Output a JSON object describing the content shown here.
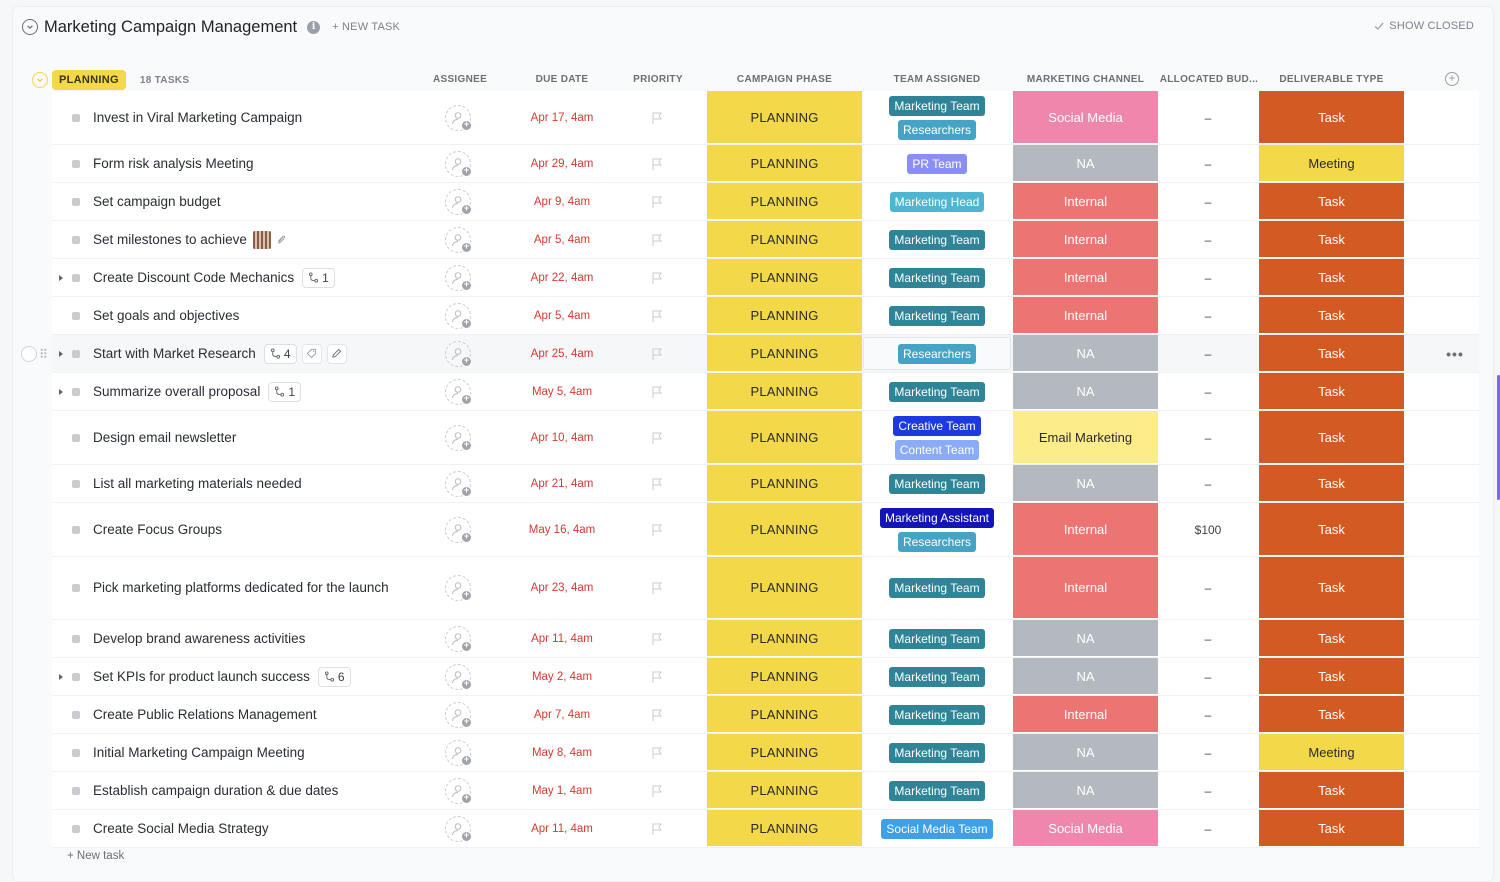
{
  "header": {
    "title": "Marketing Campaign Management",
    "new_task_label": "+ NEW TASK",
    "show_closed_label": "SHOW CLOSED"
  },
  "group": {
    "status": "PLANNING",
    "task_count": "18 TASKS",
    "status_color": "#f3d949"
  },
  "columns": {
    "assignee": "ASSIGNEE",
    "due_date": "DUE DATE",
    "priority": "PRIORITY",
    "campaign_phase": "CAMPAIGN PHASE",
    "team_assigned": "TEAM ASSIGNED",
    "marketing_channel": "MARKETING CHANNEL",
    "allocated_budget": "ALLOCATED BUD...",
    "deliverable_type": "DELIVERABLE TYPE"
  },
  "colors": {
    "team": {
      "Marketing Team": "#2f8597",
      "Researchers": "#45a4c5",
      "PR Team": "#8b8ff5",
      "Marketing Head": "#4eb6d0",
      "Creative Team": "#1c3ae0",
      "Content Team": "#8aabf7",
      "Marketing Assistant": "#1414b8",
      "Social Media Team": "#3da0e8"
    },
    "channel": {
      "Social Media": "#ee87ab",
      "NA": "#b4b9bf",
      "Internal": "#ec7473",
      "Email Marketing": "#fdec8a"
    },
    "deliverable": {
      "Task": "#d35a23",
      "Meeting": "#f3d949"
    },
    "due_date": "#d33a2f"
  },
  "tasks": [
    {
      "name": "Invest in Viral Marketing Campaign",
      "due": "Apr 17, 4am",
      "phase": "PLANNING",
      "teams": [
        "Marketing Team",
        "Researchers"
      ],
      "channel": "Social Media",
      "budget": "–",
      "deliverable": "Task"
    },
    {
      "name": "Form risk analysis Meeting",
      "due": "Apr 29, 4am",
      "phase": "PLANNING",
      "teams": [
        "PR Team"
      ],
      "channel": "NA",
      "budget": "–",
      "deliverable": "Meeting"
    },
    {
      "name": "Set campaign budget",
      "due": "Apr 9, 4am",
      "phase": "PLANNING",
      "teams": [
        "Marketing Head"
      ],
      "channel": "Internal",
      "budget": "–",
      "deliverable": "Task"
    },
    {
      "name": "Set milestones to achieve",
      "due": "Apr 5, 4am",
      "phase": "PLANNING",
      "teams": [
        "Marketing Team"
      ],
      "channel": "Internal",
      "budget": "–",
      "deliverable": "Task",
      "attachment": true
    },
    {
      "name": "Create Discount Code Mechanics",
      "due": "Apr 22, 4am",
      "phase": "PLANNING",
      "teams": [
        "Marketing Team"
      ],
      "channel": "Internal",
      "budget": "–",
      "deliverable": "Task",
      "subtasks": "1"
    },
    {
      "name": "Set goals and objectives",
      "due": "Apr 5, 4am",
      "phase": "PLANNING",
      "teams": [
        "Marketing Team"
      ],
      "channel": "Internal",
      "budget": "–",
      "deliverable": "Task"
    },
    {
      "name": "Start with Market Research",
      "due": "Apr 25, 4am",
      "phase": "PLANNING",
      "teams": [
        "Researchers"
      ],
      "channel": "NA",
      "budget": "–",
      "deliverable": "Task",
      "subtasks": "4",
      "hover": true
    },
    {
      "name": "Summarize overall proposal",
      "due": "May 5, 4am",
      "phase": "PLANNING",
      "teams": [
        "Marketing Team"
      ],
      "channel": "NA",
      "budget": "–",
      "deliverable": "Task",
      "subtasks": "1"
    },
    {
      "name": "Design email newsletter",
      "due": "Apr 10, 4am",
      "phase": "PLANNING",
      "teams": [
        "Creative Team",
        "Content Team"
      ],
      "channel": "Email Marketing",
      "budget": "–",
      "deliverable": "Task"
    },
    {
      "name": "List all marketing materials needed",
      "due": "Apr 21, 4am",
      "phase": "PLANNING",
      "teams": [
        "Marketing Team"
      ],
      "channel": "NA",
      "budget": "–",
      "deliverable": "Task"
    },
    {
      "name": "Create Focus Groups",
      "due": "May 16, 4am",
      "phase": "PLANNING",
      "teams": [
        "Marketing Assistant",
        "Researchers"
      ],
      "channel": "Internal",
      "budget": "$100",
      "deliverable": "Task"
    },
    {
      "name": "Pick marketing platforms dedicated for the launch",
      "due": "Apr 23, 4am",
      "phase": "PLANNING",
      "teams": [
        "Marketing Team"
      ],
      "channel": "Internal",
      "budget": "–",
      "deliverable": "Task"
    },
    {
      "name": "Develop brand awareness activities",
      "due": "Apr 11, 4am",
      "phase": "PLANNING",
      "teams": [
        "Marketing Team"
      ],
      "channel": "NA",
      "budget": "–",
      "deliverable": "Task"
    },
    {
      "name": "Set KPIs for product launch success",
      "due": "May 2, 4am",
      "phase": "PLANNING",
      "teams": [
        "Marketing Team"
      ],
      "channel": "NA",
      "budget": "–",
      "deliverable": "Task",
      "subtasks": "6"
    },
    {
      "name": "Create Public Relations Management",
      "due": "Apr 7, 4am",
      "phase": "PLANNING",
      "teams": [
        "Marketing Team"
      ],
      "channel": "Internal",
      "budget": "–",
      "deliverable": "Task"
    },
    {
      "name": "Initial Marketing Campaign Meeting",
      "due": "May 8, 4am",
      "phase": "PLANNING",
      "teams": [
        "Marketing Team"
      ],
      "channel": "NA",
      "budget": "–",
      "deliverable": "Meeting"
    },
    {
      "name": "Establish campaign duration & due dates",
      "due": "May 1, 4am",
      "phase": "PLANNING",
      "teams": [
        "Marketing Team"
      ],
      "channel": "NA",
      "budget": "–",
      "deliverable": "Task"
    },
    {
      "name": "Create Social Media Strategy",
      "due": "Apr 11, 4am",
      "phase": "PLANNING",
      "teams": [
        "Social Media Team"
      ],
      "channel": "Social Media",
      "budget": "–",
      "deliverable": "Task"
    }
  ],
  "footer": {
    "new_task_label": "+ New task"
  }
}
